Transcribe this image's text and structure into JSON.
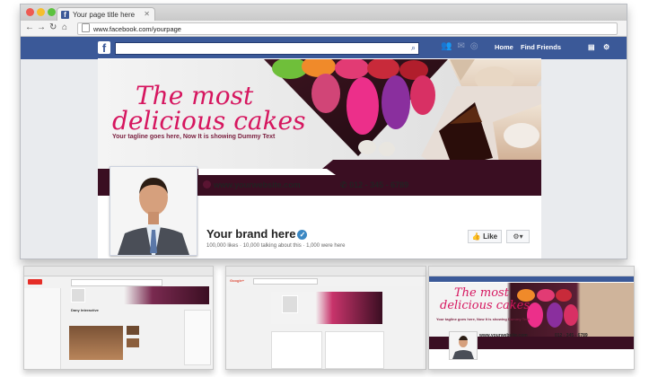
{
  "browser": {
    "tab_title": "Your page title here",
    "url": "www.facebook.com/yourpage"
  },
  "facebook": {
    "nav_home": "Home",
    "nav_find_friends": "Find Friends"
  },
  "cover": {
    "headline_line1": "The most",
    "headline_line2": "delicious cakes",
    "tagline": "Your tagline goes here, Now It is showing Dummy Text",
    "website": "www.yourwebsite.com",
    "phone": "012 - 345 - 6789"
  },
  "profile": {
    "brand_name": "Your brand here",
    "stats": "100,000 likes · 10,000 talking about this · 1,000 were here",
    "like_label": "Like"
  },
  "thumbnails": {
    "youtube_channel": "Dany Interactive",
    "google_label": "Google+",
    "third_headline_1": "The most",
    "third_headline_2": "delicious cakes",
    "third_tagline": "Your tagline goes here, Now It is showing Dummy Text",
    "third_website": "www.yourwebsite.com",
    "third_phone": "012 - 345 - 6789"
  },
  "colors": {
    "facebook_blue": "#3b5998",
    "accent_pink": "#d6165f",
    "band_dark": "#3a0e22"
  }
}
